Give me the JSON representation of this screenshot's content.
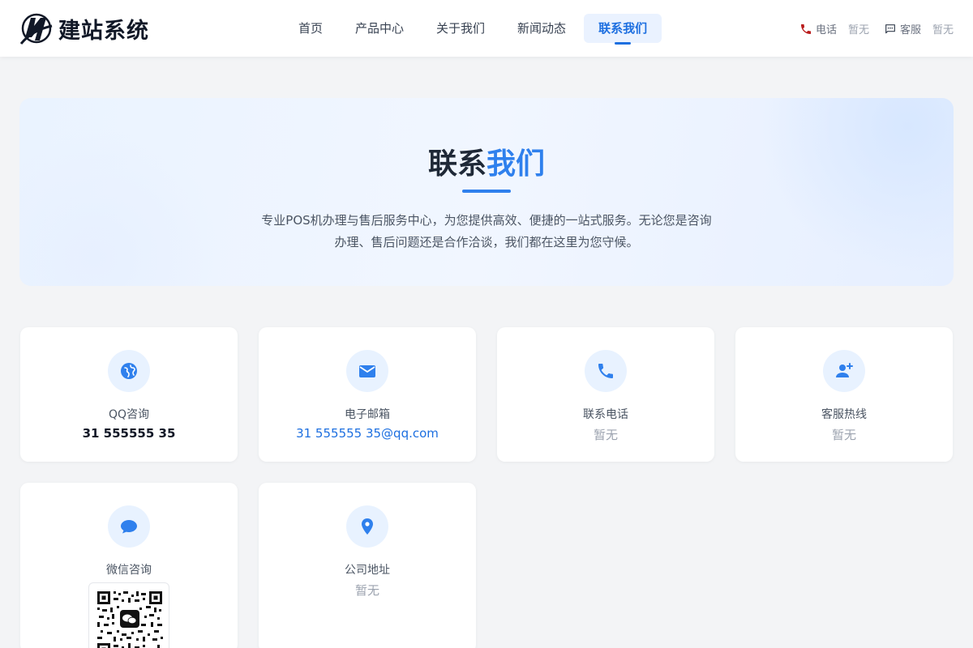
{
  "header": {
    "brand": "建站系统",
    "nav": [
      {
        "label": "首页",
        "active": false
      },
      {
        "label": "产品中心",
        "active": false
      },
      {
        "label": "关于我们",
        "active": false
      },
      {
        "label": "新闻动态",
        "active": false
      },
      {
        "label": "联系我们",
        "active": true
      }
    ],
    "phone_label": "电话",
    "phone_value": "暂无",
    "service_label": "客服",
    "service_value": "暂无"
  },
  "hero": {
    "title_main": "联系",
    "title_accent": "我们",
    "description_line1": "专业POS机办理与售后服务中心，为您提供高效、便捷的一站式服务。无论您是咨询",
    "description_line2": "办理、售后问题还是合作洽谈，我们都在这里为您守候。"
  },
  "cards": [
    {
      "label": "QQ咨询",
      "value": "31 555555 35",
      "icon": "globe-icon"
    },
    {
      "label": "电子邮箱",
      "value": "31 555555 35@qq.com",
      "icon": "mail-icon"
    },
    {
      "label": "联系电话",
      "value": "暂无",
      "icon": "phone-icon"
    },
    {
      "label": "客服热线",
      "value": "暂无",
      "icon": "person-add-icon"
    },
    {
      "label": "微信咨询",
      "value": "",
      "icon": "chat-bubble-icon"
    },
    {
      "label": "公司地址",
      "value": "暂无",
      "icon": "location-pin-icon"
    }
  ],
  "colors": {
    "accent": "#2f80ed",
    "nav_active_bg": "#eaf2ff",
    "nav_active_text": "#1d6fe0",
    "icon_bg": "#e8f2ff",
    "page_bg": "#f3f4f6"
  }
}
